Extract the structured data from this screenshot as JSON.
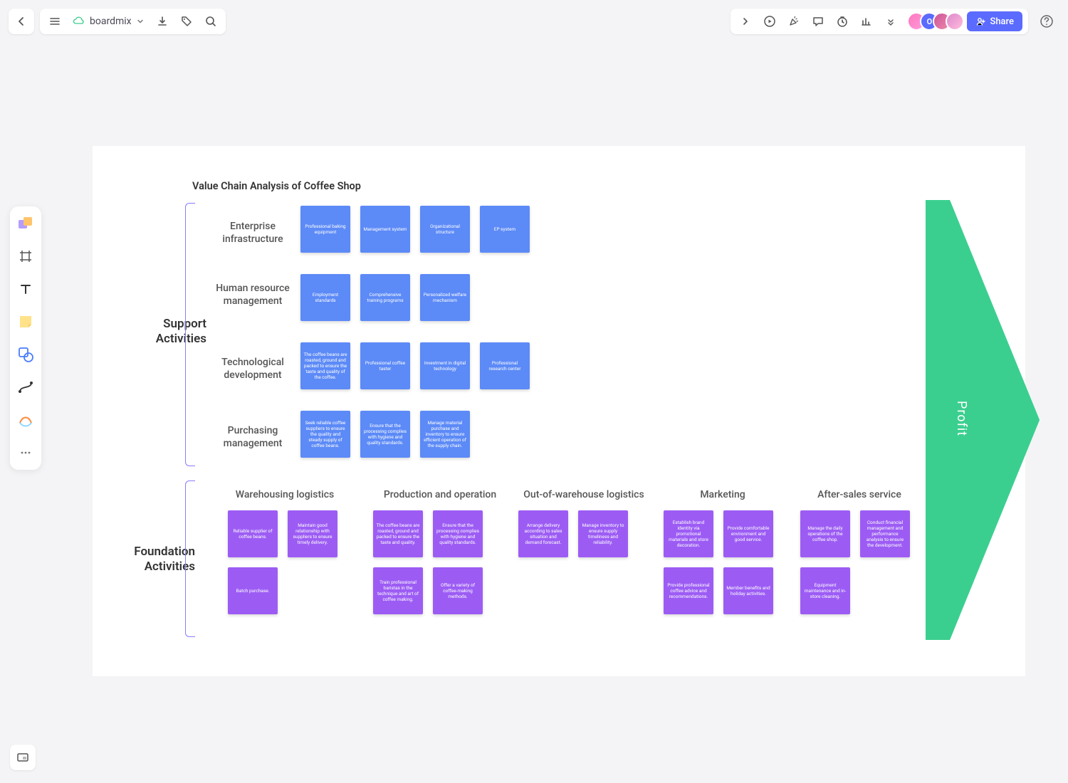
{
  "app": {
    "doc_name": "boardmix"
  },
  "toolbar": {
    "share_label": "Share",
    "avatar2_initial": "O"
  },
  "diagram": {
    "title": "Value Chain Analysis of Coffee Shop",
    "section_support": "Support Activities",
    "section_foundation": "Foundation Activities",
    "profit_label": "Profit",
    "support_rows": [
      {
        "label": "Enterprise infrastructure",
        "cards": [
          "Professional baking equipment",
          "Management system",
          "Organizational structure",
          "EP system"
        ]
      },
      {
        "label": "Human resource management",
        "cards": [
          "Employment standards",
          "Comprehensive training programs",
          "Personalized welfare mechanism"
        ]
      },
      {
        "label": "Technological development",
        "cards": [
          "The coffee beans are roasted, ground and packed to ensure the taste and quality of the coffee.",
          "Professional coffee taster",
          "Investment in digital technology",
          "Professional research center"
        ]
      },
      {
        "label": "Purchasing management",
        "cards": [
          "Seek reliable coffee suppliers to ensure the quality and steady supply of coffee beans.",
          "Ensure that the processing complies with hygiene and quality standards.",
          "Manage material purchase and inventory to ensure efficient operation of the supply chain."
        ]
      }
    ],
    "foundation_cols": [
      {
        "label": "Warehousing logistics",
        "cards": [
          "Reliable supplier of coffee beans.",
          "Maintain good relationship with suppliers to ensure timely delivery.",
          "Batch purchase."
        ]
      },
      {
        "label": "Production and operation",
        "cards": [
          "The coffee beans are roasted, ground and packed to ensure the taste and quality.",
          "Ensure that the processing complies with hygiene and quality standards.",
          "Train professional baristas in the technique and art of coffee making.",
          "Offer a variety of coffee-making methods."
        ]
      },
      {
        "label": "Out-of-warehouse logistics",
        "cards": [
          "Arrange delivery according to sales situation and demand forecast.",
          "Manage inventory to ensure supply timeliness and reliability."
        ]
      },
      {
        "label": "Marketing",
        "cards": [
          "Establish brand identity via promotional materials and store decoration.",
          "Provide comfortable environment and good service.",
          "Provide professional coffee advice and recommendations.",
          "Member benefits and holiday activities."
        ]
      },
      {
        "label": "After-sales service",
        "cards": [
          "Manage the daily operations of the coffee shop.",
          "Conduct financial management and performance analysis to ensure the development.",
          "Equipment maintenance and in-store cleaning."
        ]
      }
    ]
  }
}
